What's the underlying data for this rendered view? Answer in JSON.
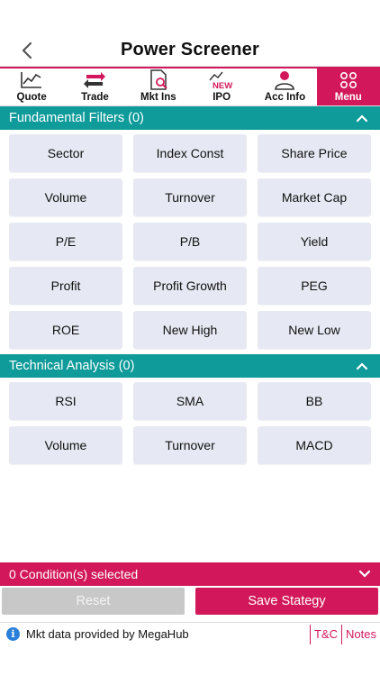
{
  "header": {
    "title": "Power Screener",
    "back_icon": "chevron-left-icon"
  },
  "nav": {
    "items": [
      {
        "label": "Quote",
        "icon": "line-chart-icon",
        "active": false
      },
      {
        "label": "Trade",
        "icon": "swap-arrows-icon",
        "active": false
      },
      {
        "label": "Mkt Ins",
        "icon": "document-search-icon",
        "active": false
      },
      {
        "label": "IPO",
        "icon": "new-chart-icon",
        "badge": "NEW",
        "active": false
      },
      {
        "label": "Acc Info",
        "icon": "user-icon",
        "active": false
      },
      {
        "label": "Menu",
        "icon": "grid-circles-icon",
        "active": true
      }
    ]
  },
  "fundamental": {
    "title": "Fundamental Filters (0)",
    "buttons": [
      "Sector",
      "Index Const",
      "Share Price",
      "Volume",
      "Turnover",
      "Market Cap",
      "P/E",
      "P/B",
      "Yield",
      "Profit",
      "Profit Growth",
      "PEG",
      "ROE",
      "New High",
      "New Low"
    ]
  },
  "technical": {
    "title": "Technical Analysis (0)",
    "buttons": [
      "RSI",
      "SMA",
      "BB",
      "Volume",
      "Turnover",
      "MACD"
    ]
  },
  "conditions": {
    "label": "0 Condition(s) selected"
  },
  "actions": {
    "reset_label": "Reset",
    "save_label": "Save Stategy"
  },
  "footer": {
    "info_text": "Mkt data provided by MegaHub",
    "tc_label": "T&C",
    "notes_label": "Notes"
  },
  "colors": {
    "accent": "#d2185a",
    "teal": "#0f9b9a",
    "button_bg": "#e6e9f3",
    "reset_bg": "#c8c8c8"
  }
}
